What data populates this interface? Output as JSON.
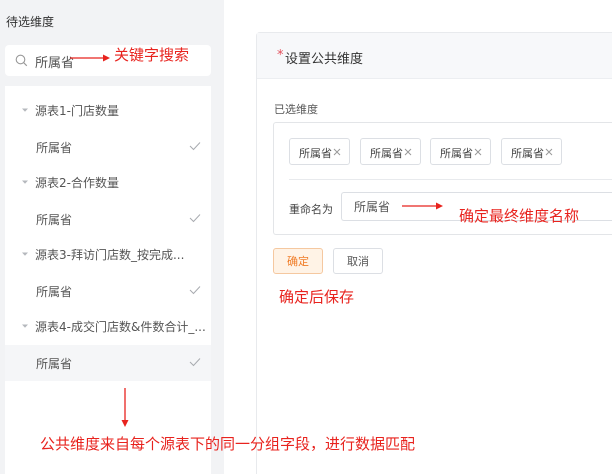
{
  "left_panel": {
    "title": "待选维度",
    "search": {
      "value": "所属省",
      "icon": "search-icon"
    },
    "tree": [
      {
        "group": "源表1-门店数量",
        "leaf": "所属省",
        "selected": false
      },
      {
        "group": "源表2-合作数量",
        "leaf": "所属省",
        "selected": false
      },
      {
        "group": "源表3-拜访门店数_按完成...",
        "leaf": "所属省",
        "selected": false
      },
      {
        "group": "源表4-成交门店数&件数合计_...",
        "leaf": "所属省",
        "selected": true
      }
    ]
  },
  "right_panel": {
    "required_mark": "*",
    "title": "设置公共维度",
    "selected_label": "已选维度",
    "tags": [
      "所属省",
      "所属省",
      "所属省",
      "所属省"
    ],
    "rename_label": "重命名为",
    "rename_value": "所属省",
    "confirm_label": "确定",
    "cancel_label": "取消"
  },
  "annotations": {
    "search_note": "关键字搜索",
    "rename_note": "确定最终维度名称",
    "save_note": "确定后保存",
    "bottom_note": "公共维度来自每个源表下的同一分组字段，进行数据匹配"
  },
  "colors": {
    "annotation_red": "#e8231e",
    "primary_orange": "#f07c27",
    "required_red": "#e34d59",
    "panel_bg": "#f2f3f5"
  }
}
